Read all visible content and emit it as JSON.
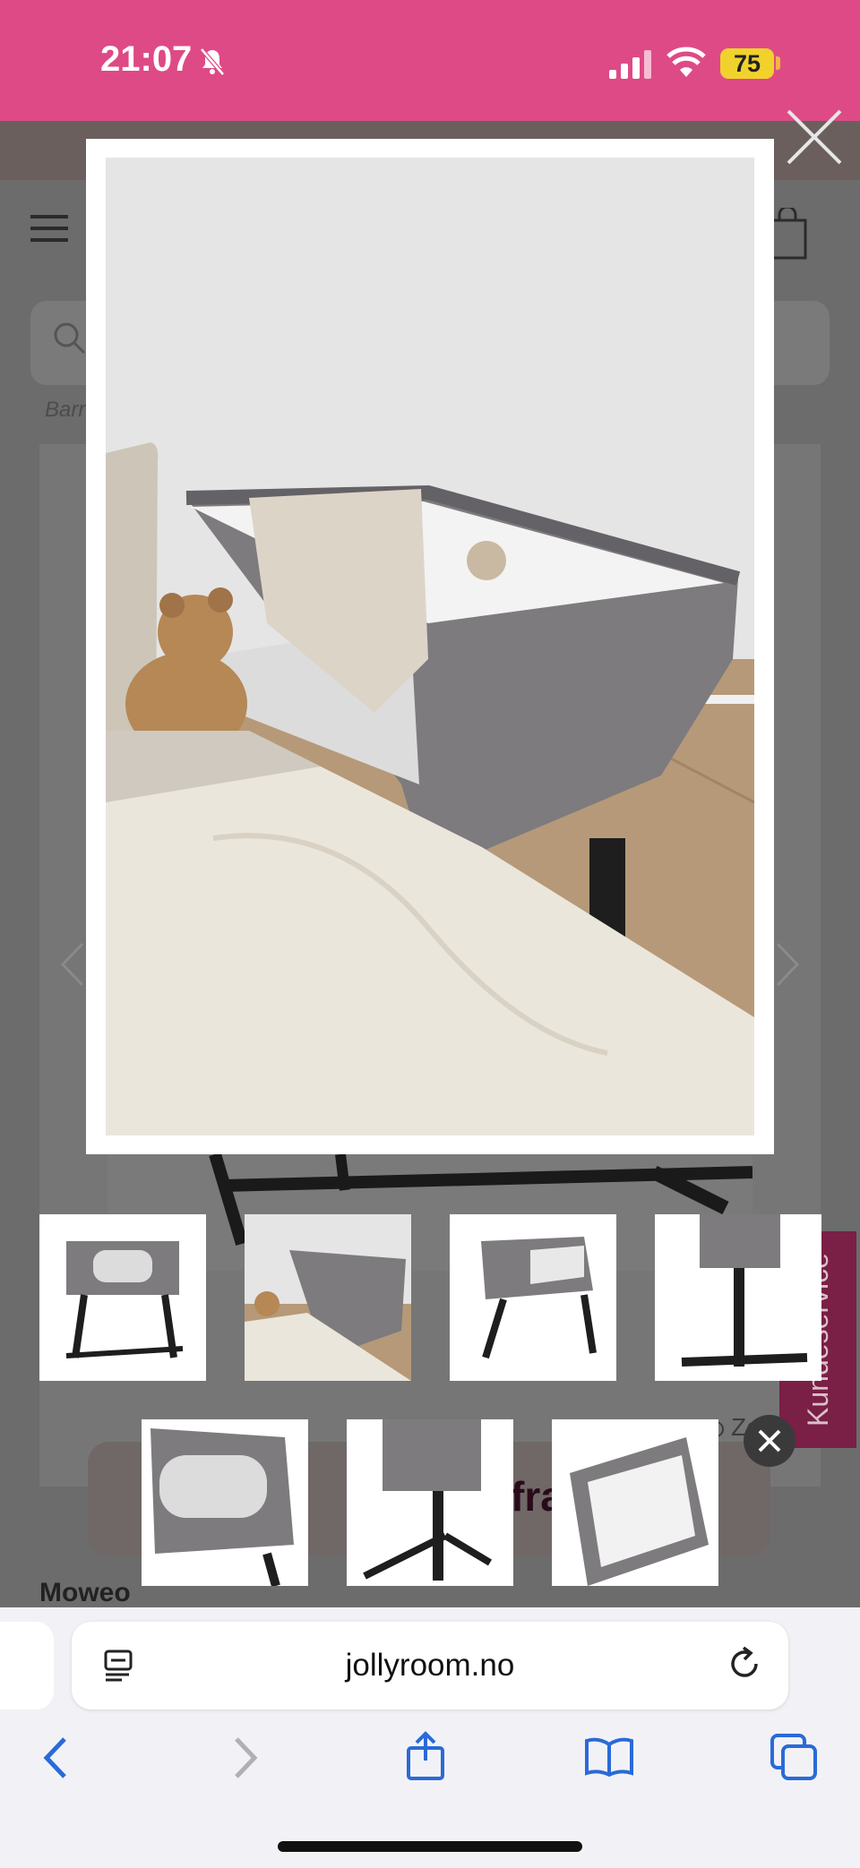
{
  "status_bar": {
    "time": "21:07",
    "battery": "75"
  },
  "page": {
    "breadcrumb": "Barn",
    "brand": "Moweo",
    "buy_button_partial": "y",
    "buy_button_partial_2": "fra",
    "zoom_hint": "Zo",
    "customer_service_tab": "Kundeservice"
  },
  "browser": {
    "url": "jollyroom.no"
  },
  "gallery": {
    "thumbnails_row1": [
      "thumb-1",
      "thumb-2",
      "thumb-3",
      "thumb-4"
    ],
    "thumbnails_row2": [
      "thumb-5",
      "thumb-6",
      "thumb-7"
    ]
  },
  "colors": {
    "accent": "#de4a86",
    "customer_service": "#7a1f45",
    "crib_fabric": "#7d7b7e",
    "crib_frame": "#1e1e1e"
  }
}
